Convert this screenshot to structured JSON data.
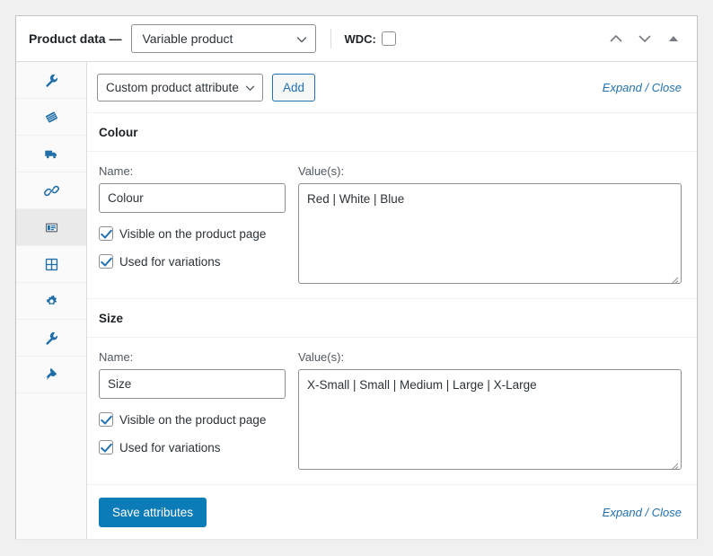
{
  "header": {
    "title": "Product data —",
    "product_type": "Variable product",
    "wdc_label": "WDC:",
    "wdc_checked": false,
    "actions": [
      {
        "name": "move-up",
        "icon": "chevron-up-icon"
      },
      {
        "name": "move-down",
        "icon": "chevron-down-icon"
      },
      {
        "name": "toggle-panel",
        "icon": "triangle-up-icon"
      }
    ]
  },
  "tabs": [
    {
      "name": "general",
      "icon": "wrench-icon",
      "active": false
    },
    {
      "name": "inventory",
      "icon": "tag-icon",
      "active": false
    },
    {
      "name": "shipping",
      "icon": "truck-icon",
      "active": false
    },
    {
      "name": "linked-products",
      "icon": "link-icon",
      "active": false
    },
    {
      "name": "attributes",
      "icon": "attributes-icon",
      "active": true
    },
    {
      "name": "variations",
      "icon": "grid-icon",
      "active": false
    },
    {
      "name": "advanced",
      "icon": "gear-icon",
      "active": false
    },
    {
      "name": "tools",
      "icon": "wrench-icon",
      "active": false
    },
    {
      "name": "plugin",
      "icon": "plug-icon",
      "active": false
    }
  ],
  "toolbar": {
    "attribute_select": "Custom product attribute",
    "add_label": "Add",
    "expand_label": "Expand",
    "separator": "/",
    "close_label": "Close"
  },
  "attributes": [
    {
      "heading": "Colour",
      "name_label": "Name:",
      "name_value": "Colour",
      "values_label": "Value(s):",
      "values_value": "Red | White | Blue",
      "visible_label": "Visible on the product page",
      "visible_checked": true,
      "variations_label": "Used for variations",
      "variations_checked": true
    },
    {
      "heading": "Size",
      "name_label": "Name:",
      "name_value": "Size",
      "values_label": "Value(s):",
      "values_value": "X-Small | Small | Medium | Large | X-Large",
      "visible_label": "Visible on the product page",
      "visible_checked": true,
      "variations_label": "Used for variations",
      "variations_checked": true
    }
  ],
  "footer": {
    "save_label": "Save attributes",
    "expand_label": "Expand",
    "separator": "/",
    "close_label": "Close"
  },
  "colors": {
    "accent": "#2271b1",
    "primary_button": "#0c7cb8",
    "icon_blue": "#1f6ea8",
    "panel_border": "#c3c4c7",
    "page_background": "#f0f0f1"
  }
}
